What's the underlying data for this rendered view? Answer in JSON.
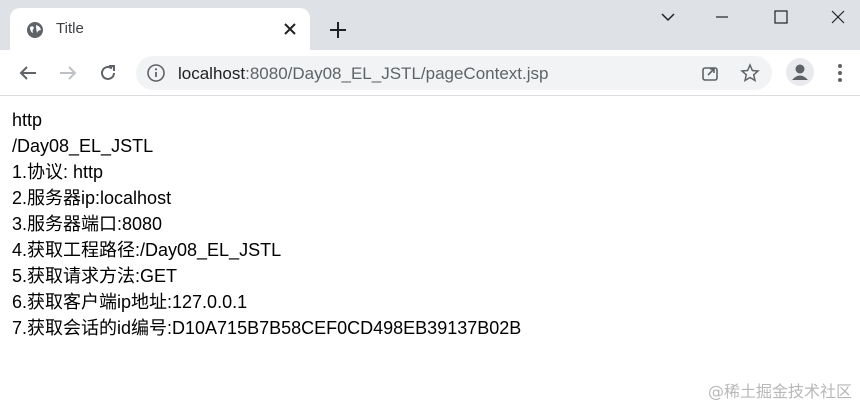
{
  "browser": {
    "tab": {
      "title": "Title",
      "favicon": "globe-icon",
      "close_icon": "close-icon"
    },
    "new_tab_icon": "plus-icon",
    "window_controls": [
      "chevron-down-icon",
      "minimize-icon",
      "maximize-icon",
      "close-icon"
    ],
    "toolbar": {
      "back_icon": "arrow-left-icon",
      "forward_icon": "arrow-right-icon",
      "reload_icon": "reload-icon",
      "url_host": "localhost",
      "url_rest": ":8080/Day08_EL_JSTL/pageContext.jsp",
      "share_icon": "share-icon",
      "bookmark_icon": "star-icon",
      "profile_icon": "person-icon",
      "menu_icon": "kebab-menu-icon"
    }
  },
  "page": {
    "lines": [
      "http",
      "/Day08_EL_JSTL",
      "1.协议: http",
      "2.服务器ip:localhost",
      "3.服务器端口:8080",
      "4.获取工程路径:/Day08_EL_JSTL",
      "5.获取请求方法:GET",
      "6.获取客户端ip地址:127.0.0.1",
      "7.获取会话的id编号:D10A715B7B58CEF0CD498EB39137B02B"
    ]
  },
  "watermark": "@稀土掘金技术社区"
}
